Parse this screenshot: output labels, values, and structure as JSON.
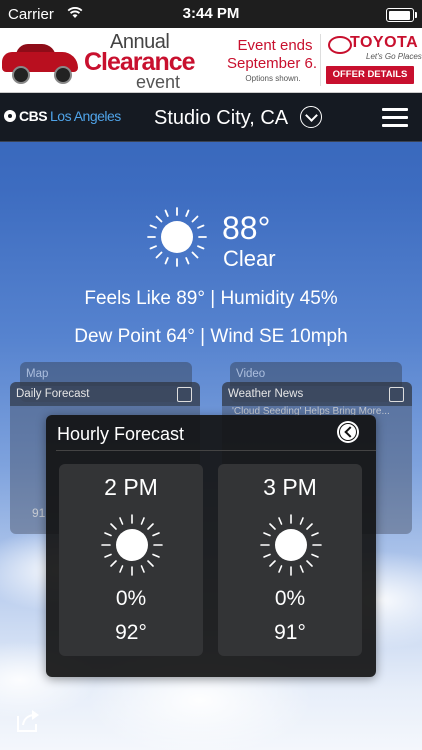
{
  "status_bar": {
    "carrier": "Carrier",
    "time": "3:44 PM"
  },
  "ad": {
    "line1": "Annual",
    "line2": "Clearance",
    "line3": "event",
    "event_ends": "Event ends",
    "event_date": "September 6.",
    "options_note": "Options shown.",
    "brand": "TOYOTA",
    "slogan": "Let's Go Places",
    "cta": "OFFER DETAILS"
  },
  "nav": {
    "logo_cbs": "CBS",
    "logo_city": "Los Angeles",
    "location": "Studio City, CA"
  },
  "current": {
    "temperature": "88°",
    "condition": "Clear",
    "details_line1": "Feels Like 89° | Humidity 45%",
    "details_line2": "Dew Point 64° | Wind SE 10mph"
  },
  "background_cards": {
    "map_label": "Map",
    "daily_forecast_label": "Daily Forecast",
    "daily_snippet": "91",
    "video_label": "Video",
    "weather_news_label": "Weather News",
    "news_snippet": "'Cloud Seeding' Helps Bring More..."
  },
  "hourly": {
    "title": "Hourly Forecast",
    "items": [
      {
        "time": "2 PM",
        "precip": "0%",
        "temp": "92°"
      },
      {
        "time": "3 PM",
        "precip": "0%",
        "temp": "91°"
      }
    ]
  },
  "colors": {
    "ad_red": "#c8102e",
    "nav_bg": "#151a22",
    "cbs_accent": "#4fa3e8"
  },
  "icons": [
    "wifi-icon",
    "battery-icon",
    "chevron-down-icon",
    "menu-icon",
    "sun-icon",
    "calendar-icon",
    "document-icon",
    "back-arrow-icon",
    "share-icon"
  ]
}
